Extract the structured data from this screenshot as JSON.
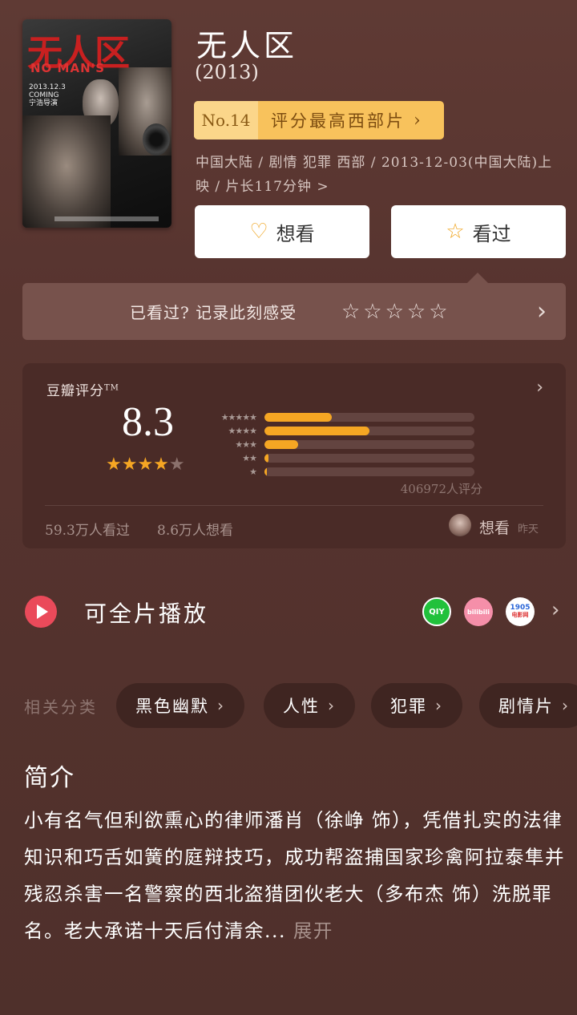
{
  "movie": {
    "poster_title": "无人区",
    "poster_en": "NO MAN'S",
    "poster_date": "2013.12.3",
    "poster_coming": "COMING",
    "poster_director": "宁浩导演",
    "title": "无人区",
    "year": "(2013)",
    "rank_no": "No.14",
    "rank_text": "评分最高西部片",
    "meta": "中国大陆 / 剧情 犯罪 西部 / 2013-12-03(中国大陆)上映 / 片长117分钟 >"
  },
  "actions": {
    "want_label": "想看",
    "seen_label": "看过",
    "record_prompt": "已看过? 记录此刻感受",
    "record_stars": "☆☆☆☆☆"
  },
  "rating": {
    "label": "豆瓣评分",
    "tm": "TM",
    "score": "8.3",
    "stars_on": "★★★★",
    "stars_off": "★",
    "count_text": "406972人评分",
    "distribution": [
      {
        "stars": "★★★★★",
        "fraction": 0.32
      },
      {
        "stars": "★★★★",
        "fraction": 0.5
      },
      {
        "stars": "★★★",
        "fraction": 0.16
      },
      {
        "stars": "★★",
        "fraction": 0.02
      },
      {
        "stars": "★",
        "fraction": 0.01
      }
    ],
    "seen_count": "59.3万人看过",
    "want_count": "8.6万人想看",
    "friend_action": "想看",
    "friend_time": "昨天"
  },
  "playback": {
    "label": "可全片播放",
    "sources": [
      "QIY",
      "bilibili",
      "1905",
      "电影网"
    ]
  },
  "categories": {
    "label": "相关分类",
    "items": [
      "黑色幽默",
      "人性",
      "犯罪",
      "剧情片"
    ]
  },
  "intro": {
    "heading": "简介",
    "text": "小有名气但利欲熏心的律师潘肖（徐峥 饰），凭借扎实的法律知识和巧舌如簧的庭辩技巧，成功帮盗捕国家珍禽阿拉泰隼并残忍杀害一名警察的西北盗猎团伙老大（多布杰 饰）洗脱罪名。老大承诺十天后付清余...",
    "more": "展开"
  },
  "colors": {
    "background": "#57342f",
    "accent": "#f5a623",
    "rank_bg": "#f8c25c",
    "play": "#ea4a5a"
  }
}
